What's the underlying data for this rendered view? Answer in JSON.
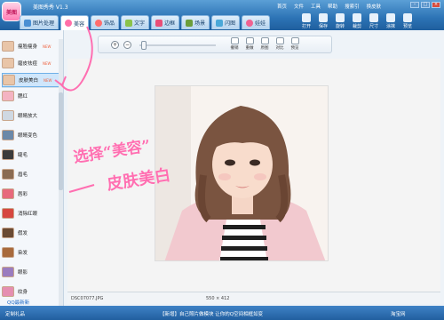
{
  "app": {
    "title": "美图秀秀 V1.3",
    "logo_text": "美图"
  },
  "top_menu": [
    "首页",
    "文件",
    "工具",
    "帮助",
    "搜索引",
    "换皮肤"
  ],
  "window_buttons": [
    "–",
    "□",
    "×"
  ],
  "tabs": [
    {
      "label": "图片处理",
      "icon": "picture-icon",
      "color": "#4a8fd3"
    },
    {
      "label": "美容",
      "icon": "beauty-icon",
      "color": "#ff6fa8"
    },
    {
      "label": "饰品",
      "icon": "heart-icon",
      "color": "#ff6d6d"
    },
    {
      "label": "文字",
      "icon": "text-icon",
      "color": "#8bc34a"
    },
    {
      "label": "边框",
      "icon": "frame-icon",
      "color": "#e94e77"
    },
    {
      "label": "场景",
      "icon": "scene-icon",
      "color": "#6c9e3b"
    },
    {
      "label": "闪图",
      "icon": "flash-icon",
      "color": "#4aa8d8"
    },
    {
      "label": "娃娃",
      "icon": "doll-icon",
      "color": "#f06292"
    }
  ],
  "right_tools": [
    "打开",
    "保存",
    "旋转",
    "裁剪",
    "尺寸",
    "涂抹",
    "预览"
  ],
  "sidebar": {
    "items": [
      {
        "label": "瘦脸瘦身",
        "badge": "NEW"
      },
      {
        "label": "磨皮祛痘",
        "badge": "NEW"
      },
      {
        "label": "皮肤美白",
        "badge": "NEW"
      },
      {
        "label": "腮红",
        "badge": ""
      },
      {
        "label": "眼睛放大",
        "badge": ""
      },
      {
        "label": "眼睛变色",
        "badge": ""
      },
      {
        "label": "睫毛",
        "badge": ""
      },
      {
        "label": "眉毛",
        "badge": ""
      },
      {
        "label": "唇彩",
        "badge": ""
      },
      {
        "label": "消除红眼",
        "badge": ""
      },
      {
        "label": "假发",
        "badge": ""
      },
      {
        "label": "染发",
        "badge": ""
      },
      {
        "label": "眼影",
        "badge": ""
      },
      {
        "label": "纹身",
        "badge": ""
      }
    ],
    "selected_index": 2,
    "footer_link": "QQ最新新"
  },
  "toolbar": {
    "buttons": [
      "撤销",
      "重做",
      "原图",
      "对比",
      "预览"
    ]
  },
  "annotation": {
    "line1": "选择“美容”",
    "line2": "皮肤美白"
  },
  "status": {
    "filename": "DSC07077.JPG",
    "size": "550 × 412"
  },
  "bottom_bar": {
    "left": "定制礼品",
    "center": "【新增】自己照片做模块 让你的Q空间相框如变",
    "right": "淘宝网"
  }
}
